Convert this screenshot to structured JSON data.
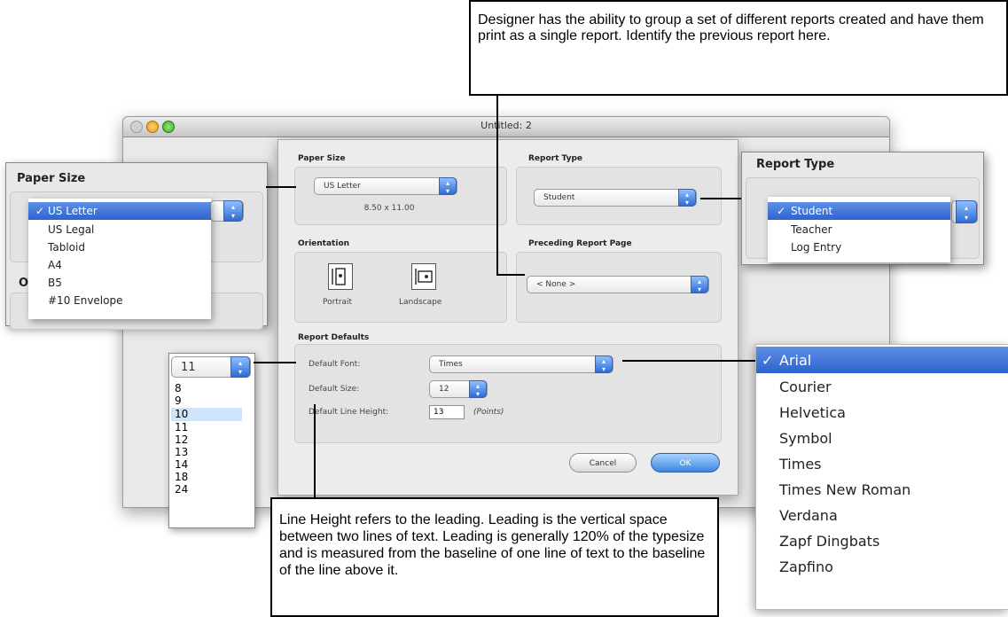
{
  "window": {
    "title": "Untitled: 2"
  },
  "sheet": {
    "paper_size": {
      "label": "Paper Size",
      "selected": "US Letter",
      "dimensions": "8.50 x 11.00"
    },
    "report_type": {
      "label": "Report Type",
      "selected": "Student"
    },
    "orientation": {
      "label": "Orientation",
      "portrait_label": "Portrait",
      "landscape_label": "Landscape"
    },
    "preceding": {
      "label": "Preceding Report Page",
      "selected": "< None >"
    },
    "defaults": {
      "label": "Report Defaults",
      "font_label": "Default Font:",
      "font_value": "Times",
      "size_label": "Default Size:",
      "size_value": "12",
      "line_height_label": "Default Line Height:",
      "line_height_value": "13",
      "points_label": "(Points)"
    },
    "cancel_label": "Cancel",
    "ok_label": "OK"
  },
  "paper_size_panel": {
    "title": "Paper Size",
    "items": [
      "US Letter",
      "US Legal",
      "Tabloid",
      "A4",
      "B5",
      "#10 Envelope"
    ],
    "selected_index": 0,
    "clipped_label": "O"
  },
  "report_type_panel": {
    "title": "Report Type",
    "items": [
      "Student",
      "Teacher",
      "Log Entry"
    ],
    "selected_index": 0
  },
  "size_list": {
    "current": "11",
    "items": [
      "8",
      "9",
      "10",
      "11",
      "12",
      "13",
      "14",
      "18",
      "24"
    ],
    "highlight_index": 2
  },
  "font_menu": {
    "items": [
      "Arial",
      "Courier",
      "Helvetica",
      "Symbol",
      "Times",
      "Times New Roman",
      "Verdana",
      "Zapf Dingbats",
      "Zapfino"
    ],
    "selected_index": 0
  },
  "callout_top": "Designer has the ability to group a set of different reports created and have them print as a single report. Identify the previous report here.",
  "callout_bottom": "Line Height refers to the leading. Leading is the vertical space between two lines of text. Leading is generally 120% of the typesize and is measured from the baseline of one line of text to the baseline of the line above it.",
  "checkmark": "✓",
  "arrow_glyph": "▴▾",
  "colors": {
    "selection": "#3a6fd8",
    "ok_button": "#4a90e2"
  }
}
